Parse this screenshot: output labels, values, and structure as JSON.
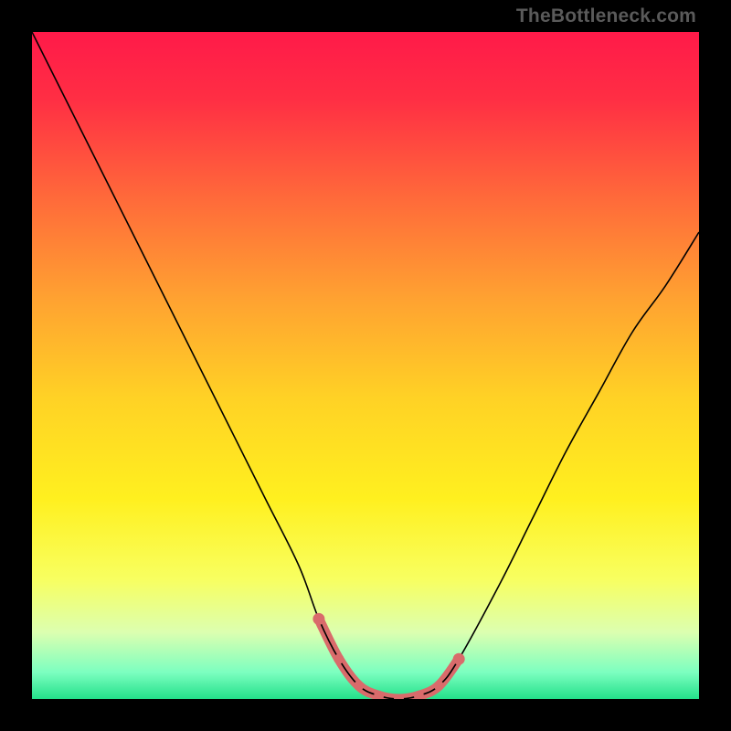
{
  "watermark": "TheBottleneck.com",
  "gradient_stops": [
    {
      "offset": 0.0,
      "color": "#ff1a49"
    },
    {
      "offset": 0.1,
      "color": "#ff2e44"
    },
    {
      "offset": 0.25,
      "color": "#ff6a3a"
    },
    {
      "offset": 0.4,
      "color": "#ffa231"
    },
    {
      "offset": 0.55,
      "color": "#ffd225"
    },
    {
      "offset": 0.7,
      "color": "#fff01f"
    },
    {
      "offset": 0.82,
      "color": "#f8ff60"
    },
    {
      "offset": 0.9,
      "color": "#dcffb0"
    },
    {
      "offset": 0.96,
      "color": "#7cffc0"
    },
    {
      "offset": 1.0,
      "color": "#23e08a"
    }
  ],
  "chart_data": {
    "type": "line",
    "title": "",
    "xlabel": "",
    "ylabel": "",
    "xlim": [
      0,
      100
    ],
    "ylim": [
      0,
      100
    ],
    "series": [
      {
        "name": "bottleneck-curve",
        "x": [
          0,
          5,
          10,
          15,
          20,
          25,
          30,
          35,
          40,
          43,
          46,
          49,
          52,
          55,
          58,
          61,
          64,
          70,
          75,
          80,
          85,
          90,
          95,
          100
        ],
        "values": [
          100,
          90,
          80,
          70,
          60,
          50,
          40,
          30,
          20,
          12,
          6,
          2,
          0.5,
          0,
          0.5,
          2,
          6,
          17,
          27,
          37,
          46,
          55,
          62,
          70
        ]
      }
    ],
    "highlight_band": {
      "x_start": 43,
      "x_end": 64,
      "y_max": 6
    },
    "highlight_color": "#d96b6b"
  }
}
